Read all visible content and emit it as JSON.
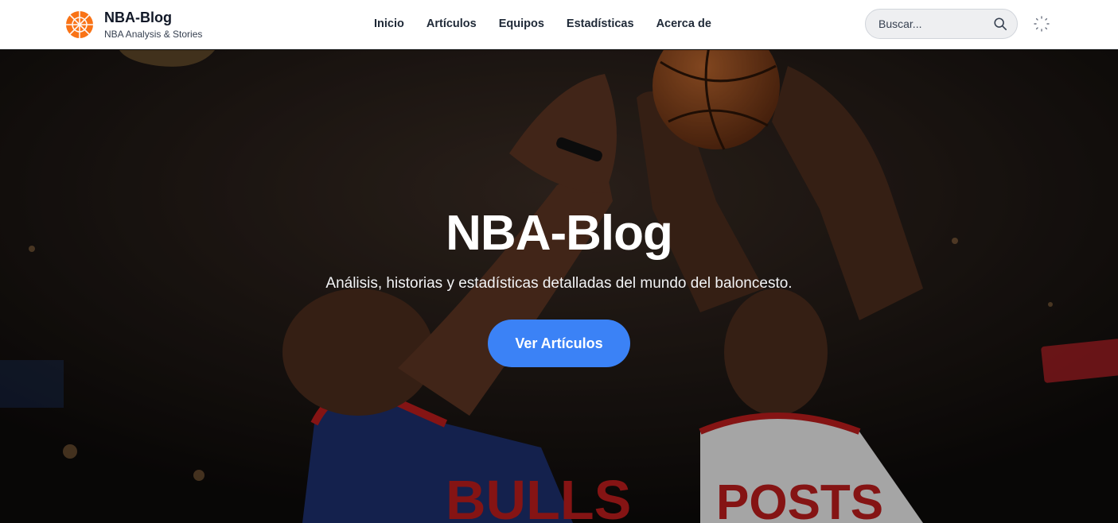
{
  "brand": {
    "title": "NBA-Blog",
    "subtitle": "NBA Analysis & Stories",
    "logo_icon": "basketball-icon",
    "logo_color": "#f97316"
  },
  "nav": {
    "items": [
      {
        "label": "Inicio"
      },
      {
        "label": "Artículos"
      },
      {
        "label": "Equipos"
      },
      {
        "label": "Estadísticas"
      },
      {
        "label": "Acerca de"
      }
    ]
  },
  "search": {
    "placeholder": "Buscar...",
    "value": "",
    "icon": "search-icon"
  },
  "theme_toggle": {
    "icon": "sun-icon"
  },
  "hero": {
    "title": "NBA-Blog",
    "subtitle": "Análisis, historias y estadísticas detalladas del mundo del baloncesto.",
    "cta_label": "Ver Artículos",
    "cta_color": "#3b82f6",
    "background": "basketball-players-photo",
    "jersey_left": "BULLS",
    "jersey_right": "POSTS"
  },
  "colors": {
    "header_bg": "#ffffff",
    "accent": "#3b82f6",
    "text_dark": "#111827"
  }
}
